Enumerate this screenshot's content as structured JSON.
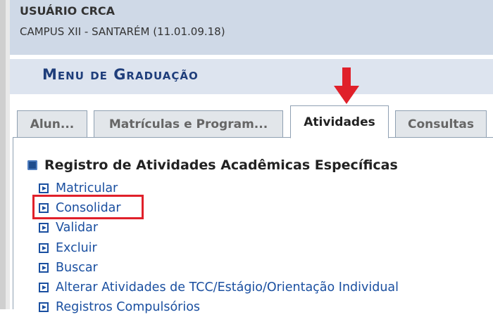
{
  "header": {
    "user_name": "USUÁRIO CRCA",
    "campus": "CAMPUS XII - SANTARÉM (11.01.09.18)"
  },
  "menu": {
    "title": "Menu de Graduação"
  },
  "tabs": [
    {
      "label": "Alun..."
    },
    {
      "label": "Matrículas e Program..."
    },
    {
      "label": "Atividades"
    },
    {
      "label": "Consultas"
    }
  ],
  "active_tab": "Atividades",
  "section": {
    "title": "Registro de Atividades Acadêmicas Específicas",
    "links": [
      {
        "label": "Matricular"
      },
      {
        "label": "Consolidar"
      },
      {
        "label": "Validar"
      },
      {
        "label": "Excluir"
      },
      {
        "label": "Buscar"
      },
      {
        "label": "Alterar Atividades de TCC/Estágio/Orientação Individual"
      },
      {
        "label": "Registros Compulsórios"
      }
    ]
  },
  "colors": {
    "header_bg": "#cfd9e7",
    "menu_title": "#1f3e7b",
    "link": "#1a4fa0",
    "annotation_red": "#e0202a"
  },
  "icons": [
    "arrow-down-icon",
    "section-bullet-icon",
    "link-arrow-icon"
  ]
}
